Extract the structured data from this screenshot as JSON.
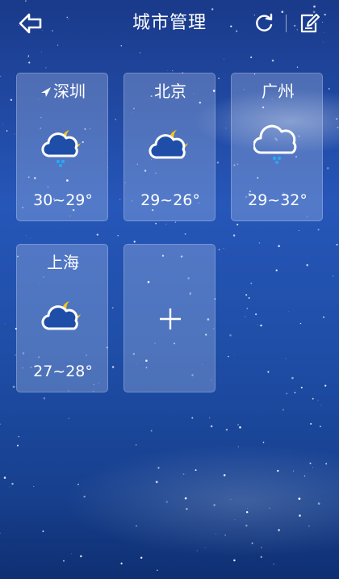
{
  "header": {
    "title": "城市管理",
    "back_icon": "back-arrow-icon",
    "refresh_icon": "refresh-icon",
    "edit_icon": "edit-icon"
  },
  "cities": [
    {
      "name": "深圳",
      "located": true,
      "temp": "30~29°",
      "weather_icon": "cloudy-night-rain-icon"
    },
    {
      "name": "北京",
      "located": false,
      "temp": "29~26°",
      "weather_icon": "cloudy-night-icon"
    },
    {
      "name": "广州",
      "located": false,
      "temp": "29~32°",
      "weather_icon": "cloud-rain-icon"
    },
    {
      "name": "上海",
      "located": false,
      "temp": "27~28°",
      "weather_icon": "cloudy-night-icon"
    }
  ],
  "add_city_icon": "plus-icon",
  "colors": {
    "moon": "#f5c518",
    "rain": "#2aa8f2",
    "text": "#ffffff"
  }
}
